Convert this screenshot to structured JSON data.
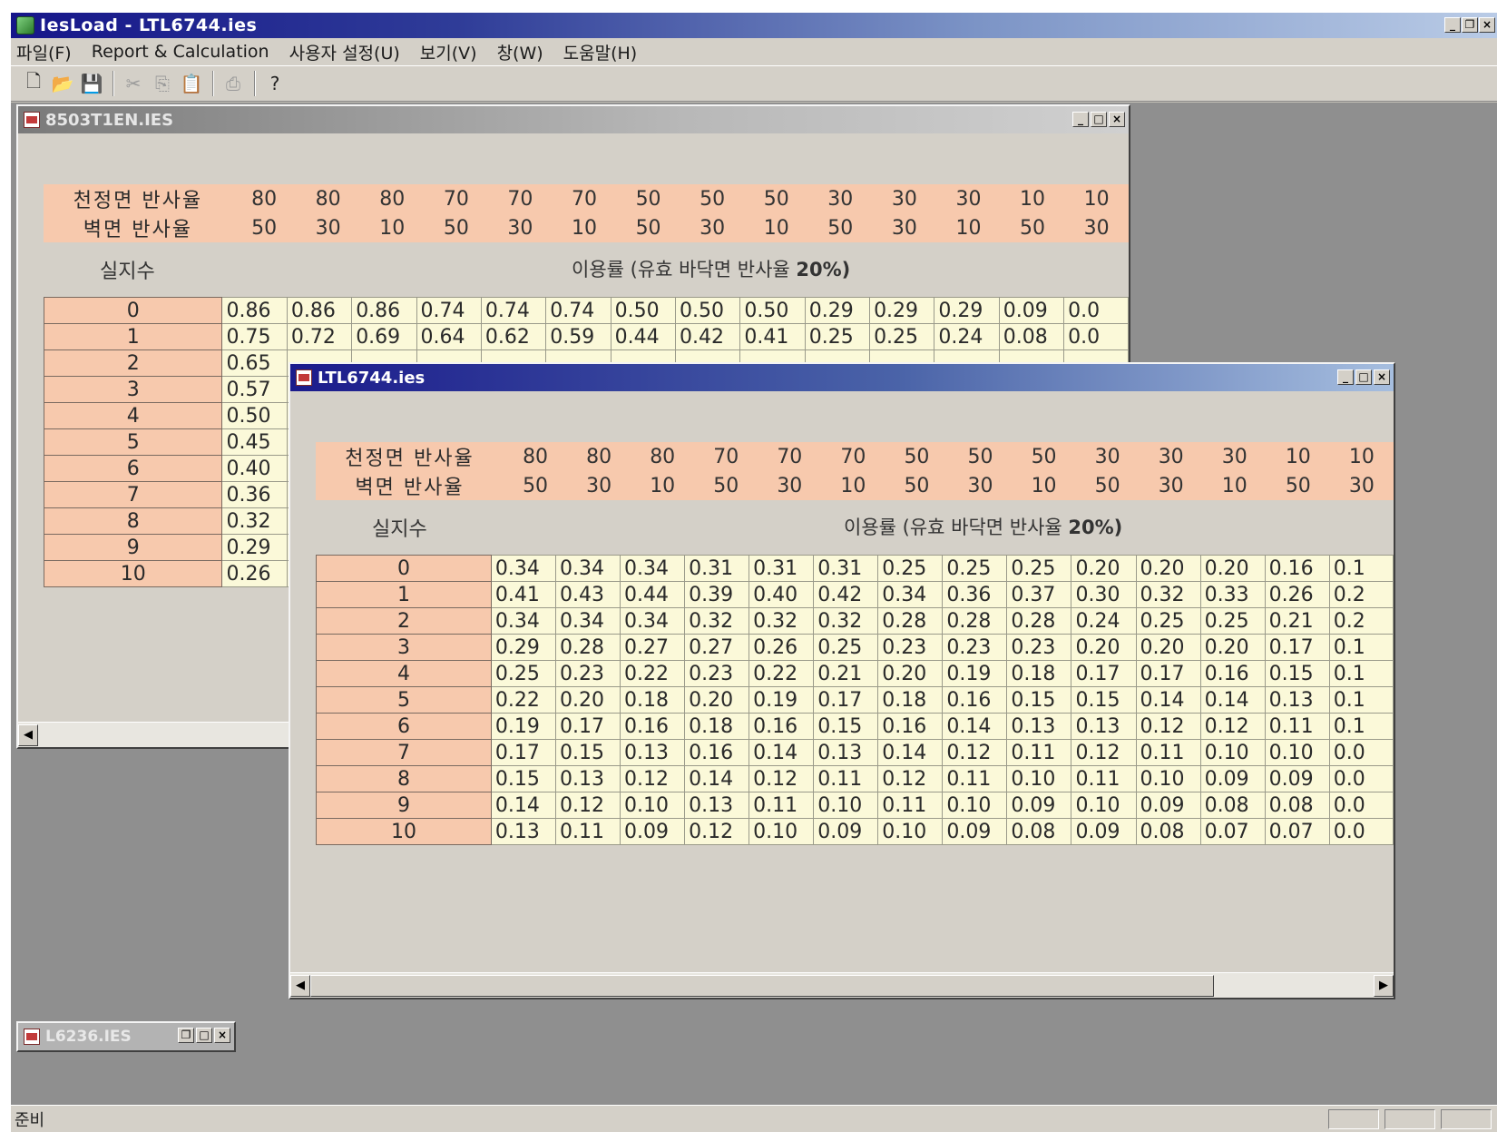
{
  "app": {
    "title": "IesLoad - LTL6744.ies"
  },
  "menu": [
    "파일(F)",
    "Report & Calculation",
    "사용자 설정(U)",
    "보기(V)",
    "창(W)",
    "도움말(H)"
  ],
  "toolbar": {
    "buttons": [
      {
        "name": "new-file-icon",
        "glyph": "🗋",
        "enabled": true
      },
      {
        "name": "open-folder-icon",
        "glyph": "📂",
        "enabled": true
      },
      {
        "name": "save-disk-icon",
        "glyph": "💾",
        "enabled": true
      },
      {
        "name": "cut-icon",
        "glyph": "✂",
        "enabled": false
      },
      {
        "name": "copy-icon",
        "glyph": "⎘",
        "enabled": false
      },
      {
        "name": "paste-icon",
        "glyph": "📋",
        "enabled": false
      },
      {
        "name": "print-icon",
        "glyph": "⎙",
        "enabled": false
      },
      {
        "name": "help-icon",
        "glyph": "?",
        "enabled": true
      }
    ]
  },
  "labels": {
    "ceiling": "천정면 반사율",
    "wall": "벽면 반사율",
    "room_index": "실지수",
    "util_prefix": "이용률 (유효 바닥면 반사율 ",
    "util_bold": "20%)"
  },
  "reflectance": {
    "ceiling": [
      "80",
      "80",
      "80",
      "70",
      "70",
      "70",
      "50",
      "50",
      "50",
      "30",
      "30",
      "30",
      "10",
      "10"
    ],
    "wall": [
      "50",
      "30",
      "10",
      "50",
      "30",
      "10",
      "50",
      "30",
      "10",
      "50",
      "30",
      "10",
      "50",
      "30"
    ]
  },
  "windows": {
    "back": {
      "title": "8503T1EN.IES",
      "rows": [
        "0",
        "1",
        "2",
        "3",
        "4",
        "5",
        "6",
        "7",
        "8",
        "9",
        "10"
      ],
      "values": [
        [
          "0.86",
          "0.86",
          "0.86",
          "0.74",
          "0.74",
          "0.74",
          "0.50",
          "0.50",
          "0.50",
          "0.29",
          "0.29",
          "0.29",
          "0.09",
          "0.0"
        ],
        [
          "0.75",
          "0.72",
          "0.69",
          "0.64",
          "0.62",
          "0.59",
          "0.44",
          "0.42",
          "0.41",
          "0.25",
          "0.25",
          "0.24",
          "0.08",
          "0.0"
        ],
        [
          "0.65"
        ],
        [
          "0.57"
        ],
        [
          "0.50"
        ],
        [
          "0.45"
        ],
        [
          "0.40"
        ],
        [
          "0.36"
        ],
        [
          "0.32"
        ],
        [
          "0.29"
        ],
        [
          "0.26"
        ]
      ]
    },
    "front": {
      "title": "LTL6744.ies",
      "rows": [
        "0",
        "1",
        "2",
        "3",
        "4",
        "5",
        "6",
        "7",
        "8",
        "9",
        "10"
      ],
      "values": [
        [
          "0.34",
          "0.34",
          "0.34",
          "0.31",
          "0.31",
          "0.31",
          "0.25",
          "0.25",
          "0.25",
          "0.20",
          "0.20",
          "0.20",
          "0.16",
          "0.1"
        ],
        [
          "0.41",
          "0.43",
          "0.44",
          "0.39",
          "0.40",
          "0.42",
          "0.34",
          "0.36",
          "0.37",
          "0.30",
          "0.32",
          "0.33",
          "0.26",
          "0.2"
        ],
        [
          "0.34",
          "0.34",
          "0.34",
          "0.32",
          "0.32",
          "0.32",
          "0.28",
          "0.28",
          "0.28",
          "0.24",
          "0.25",
          "0.25",
          "0.21",
          "0.2"
        ],
        [
          "0.29",
          "0.28",
          "0.27",
          "0.27",
          "0.26",
          "0.25",
          "0.23",
          "0.23",
          "0.23",
          "0.20",
          "0.20",
          "0.20",
          "0.17",
          "0.1"
        ],
        [
          "0.25",
          "0.23",
          "0.22",
          "0.23",
          "0.22",
          "0.21",
          "0.20",
          "0.19",
          "0.18",
          "0.17",
          "0.17",
          "0.16",
          "0.15",
          "0.1"
        ],
        [
          "0.22",
          "0.20",
          "0.18",
          "0.20",
          "0.19",
          "0.17",
          "0.18",
          "0.16",
          "0.15",
          "0.15",
          "0.14",
          "0.14",
          "0.13",
          "0.1"
        ],
        [
          "0.19",
          "0.17",
          "0.16",
          "0.18",
          "0.16",
          "0.15",
          "0.16",
          "0.14",
          "0.13",
          "0.13",
          "0.12",
          "0.12",
          "0.11",
          "0.1"
        ],
        [
          "0.17",
          "0.15",
          "0.13",
          "0.16",
          "0.14",
          "0.13",
          "0.14",
          "0.12",
          "0.11",
          "0.12",
          "0.11",
          "0.10",
          "0.10",
          "0.0"
        ],
        [
          "0.15",
          "0.13",
          "0.12",
          "0.14",
          "0.12",
          "0.11",
          "0.12",
          "0.11",
          "0.10",
          "0.11",
          "0.10",
          "0.09",
          "0.09",
          "0.0"
        ],
        [
          "0.14",
          "0.12",
          "0.10",
          "0.13",
          "0.11",
          "0.10",
          "0.11",
          "0.10",
          "0.09",
          "0.10",
          "0.09",
          "0.08",
          "0.08",
          "0.0"
        ],
        [
          "0.13",
          "0.11",
          "0.09",
          "0.12",
          "0.10",
          "0.09",
          "0.10",
          "0.09",
          "0.08",
          "0.09",
          "0.08",
          "0.07",
          "0.07",
          "0.0"
        ]
      ]
    },
    "minimized": {
      "title": "L6236.IES"
    }
  },
  "status": {
    "text": "준비"
  },
  "colors": {
    "header_bg": "#f7c9ad",
    "cell_bg": "#fbf9d9",
    "active_title": "#1b1b8c"
  }
}
